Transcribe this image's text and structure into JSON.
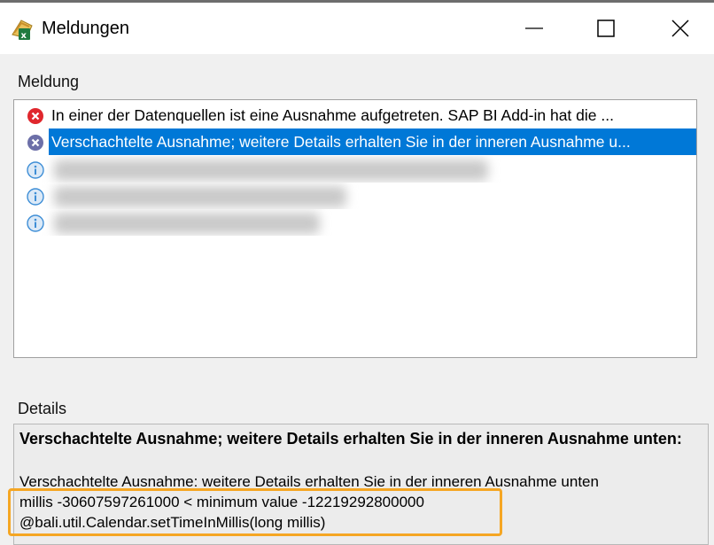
{
  "window": {
    "title": "Meldungen",
    "app_icon": "excel-sap-bi-icon",
    "buttons": {
      "minimize": "minimize-icon",
      "maximize": "maximize-icon",
      "close": "close-icon"
    }
  },
  "messages": {
    "label": "Meldung",
    "rows": [
      {
        "icon": "error-icon",
        "text": "In einer der Datenquellen ist eine Ausnahme aufgetreten.      SAP BI Add-in hat die ..."
      },
      {
        "icon": "error-icon",
        "text": "Verschachtelte Ausnahme; weitere Details erhalten Sie in der inneren Ausnahme u...",
        "selected": true
      },
      {
        "icon": "info-icon",
        "text": ""
      },
      {
        "icon": "info-icon",
        "text": ""
      },
      {
        "icon": "info-icon",
        "text": ""
      }
    ]
  },
  "details": {
    "label": "Details",
    "heading": "Verschachtelte Ausnahme; weitere Details erhalten Sie in der inneren Ausnahme unten:",
    "lines": [
      "Verschachtelte Ausnahme: weitere Details erhalten Sie in der inneren Ausnahme unten",
      "millis -30607597261000 <  minimum value -12219292800000",
      "@bali.util.Calendar.setTimeInMillis(long millis)"
    ]
  },
  "colors": {
    "selection": "#0078d7",
    "error": "#e0272d",
    "info": "#3e8ed6",
    "highlight_border": "#f5a623"
  }
}
